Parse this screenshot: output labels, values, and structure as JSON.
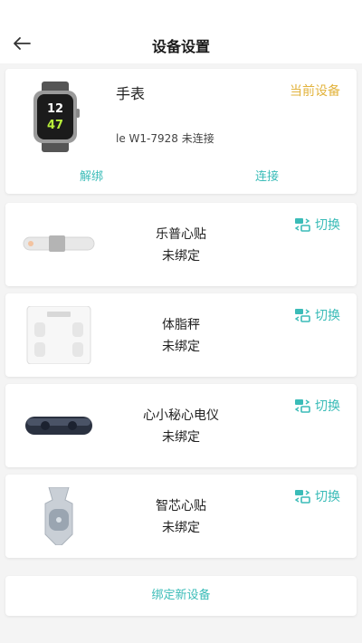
{
  "header": {
    "title": "设备设置",
    "back_icon": "arrow-left-icon"
  },
  "current_device": {
    "name": "手表",
    "tag": "当前设备",
    "id_status": "le W1-7928 未连接",
    "unbind_label": "解绑",
    "connect_label": "连接",
    "image_icon": "smartwatch-image",
    "watch_face_text": "12 47"
  },
  "devices": [
    {
      "name": "乐普心贴",
      "status": "未绑定",
      "switch_label": "切换",
      "image_icon": "ecg-patch-image"
    },
    {
      "name": "体脂秤",
      "status": "未绑定",
      "switch_label": "切换",
      "image_icon": "body-fat-scale-image"
    },
    {
      "name": "心小秘心电仪",
      "status": "未绑定",
      "switch_label": "切换",
      "image_icon": "ecg-monitor-image"
    },
    {
      "name": "智芯心贴",
      "status": "未绑定",
      "switch_label": "切换",
      "image_icon": "smart-heart-patch-image"
    }
  ],
  "bind_new_label": "绑定新设备",
  "colors": {
    "accent": "#3bbcb8",
    "current_tag": "#e2b33d",
    "background": "#f4f4f4",
    "card": "#ffffff"
  }
}
